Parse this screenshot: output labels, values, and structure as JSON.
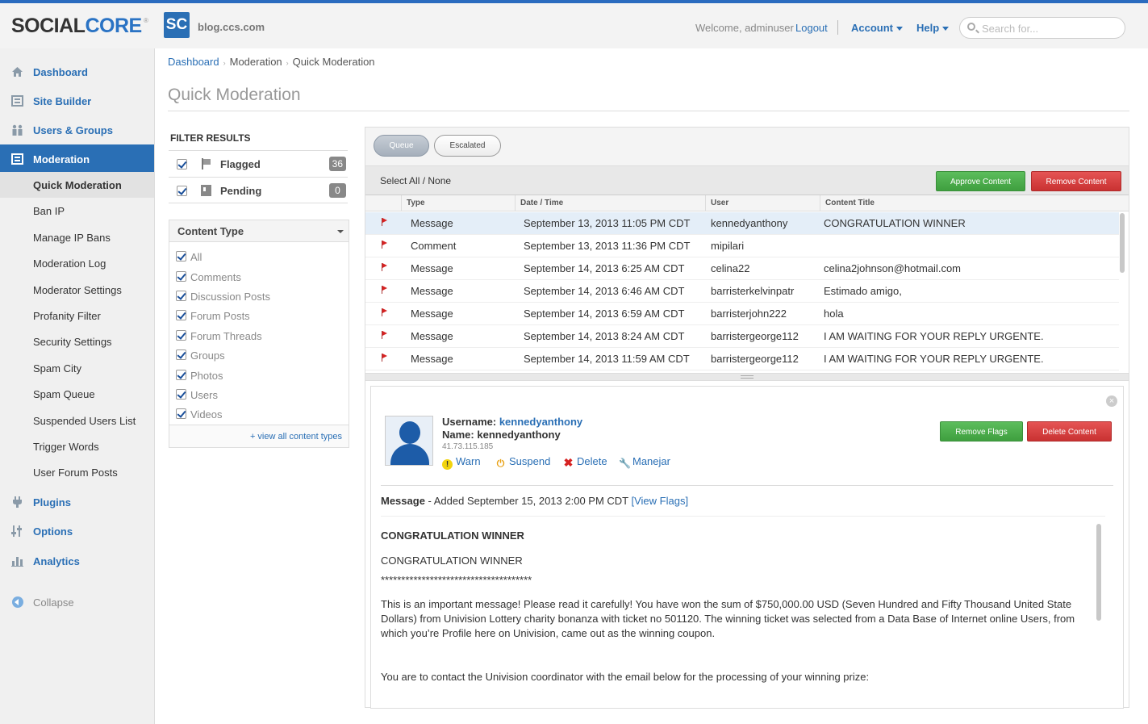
{
  "header": {
    "logo_social": "SOCIAL",
    "logo_core": "CORE",
    "logo_reg": "®",
    "site_badge": "SC",
    "site_url": "blog.ccs.com",
    "welcome": "Welcome, adminuser",
    "logout": "Logout",
    "account": "Account",
    "help": "Help",
    "search_placeholder": "Search for..."
  },
  "sidebar": {
    "main": [
      {
        "label": "Dashboard",
        "icon": "home-icon"
      },
      {
        "label": "Site Builder",
        "icon": "site-builder-icon"
      },
      {
        "label": "Users & Groups",
        "icon": "users-icon"
      },
      {
        "label": "Moderation",
        "icon": "moderation-icon"
      }
    ],
    "sub": [
      "Quick Moderation",
      "Ban IP",
      "Manage IP Bans",
      "Moderation Log",
      "Moderator Settings",
      "Profanity Filter",
      "Security Settings",
      "Spam City",
      "Spam Queue",
      "Suspended Users List",
      "Trigger Words",
      "User Forum Posts"
    ],
    "main2": [
      {
        "label": "Plugins",
        "icon": "plug-icon"
      },
      {
        "label": "Options",
        "icon": "options-icon"
      },
      {
        "label": "Analytics",
        "icon": "analytics-icon"
      }
    ],
    "collapse": "Collapse"
  },
  "breadcrumb": [
    "Dashboard",
    "Moderation",
    "Quick Moderation"
  ],
  "page_title": "Quick Moderation",
  "filter": {
    "heading": "FILTER RESULTS",
    "items": [
      {
        "label": "Flagged",
        "count": "36"
      },
      {
        "label": "Pending",
        "count": "0"
      }
    ]
  },
  "content_type": {
    "heading": "Content Type",
    "items": [
      "All",
      "Comments",
      "Discussion Posts",
      "Forum Posts",
      "Forum Threads",
      "Groups",
      "Photos",
      "Users",
      "Videos"
    ],
    "view_all": "+ view all content types"
  },
  "queue": {
    "tabs": [
      "Queue",
      "Escalated"
    ],
    "select_all": "Select All / None",
    "approve": "Approve Content",
    "remove": "Remove Content",
    "columns": [
      "Type",
      "Date / Time",
      "User",
      "Content Title"
    ],
    "rows": [
      {
        "type": "Message",
        "date": "September 13, 2013 11:05 PM CDT",
        "user": "kennedyanthony",
        "title": "CONGRATULATION WINNER"
      },
      {
        "type": "Comment",
        "date": "September 13, 2013 11:36 PM CDT",
        "user": "mipilari",
        "title": ""
      },
      {
        "type": "Message",
        "date": "September 14, 2013 6:25 AM CDT",
        "user": "celina22",
        "title": "celina2johnson@hotmail.com"
      },
      {
        "type": "Message",
        "date": "September 14, 2013 6:46 AM CDT",
        "user": "barristerkelvinpatr",
        "title": "Estimado amigo,"
      },
      {
        "type": "Message",
        "date": "September 14, 2013 6:59 AM CDT",
        "user": "barristerjohn222",
        "title": "hola"
      },
      {
        "type": "Message",
        "date": "September 14, 2013 8:24 AM CDT",
        "user": "barristergeorge112",
        "title": "I AM WAITING FOR YOUR REPLY URGENTE."
      },
      {
        "type": "Message",
        "date": "September 14, 2013 11:59 AM CDT",
        "user": "barristergeorge112",
        "title": "I AM WAITING FOR YOUR REPLY URGENTE."
      }
    ]
  },
  "detail": {
    "username_label": "Username:",
    "username": "kennedyanthony",
    "name_label": "Name:",
    "name": "kennedyanthony",
    "ip": "41.73.115.185",
    "actions": [
      "Warn",
      "Suspend",
      "Delete",
      "Manejar"
    ],
    "remove_flags": "Remove Flags",
    "delete_content": "Delete Content",
    "meta_type": "Message",
    "meta_added": " - Added September 15, 2013 2:00 PM CDT ",
    "meta_link": "[View Flags]",
    "body": [
      "CONGRATULATION WINNER",
      "CONGRATULATION WINNER",
      "*************************************",
      "This is an important message! Please read it carefully! You have won the sum of $750,000.00 USD (Seven Hundred and Fifty Thousand United State Dollars) from Univision Lottery charity bonanza with ticket no 501120. The winning ticket was selected from a Data Base of Internet online Users, from which you’re Profile here on Univision, came out as the winning coupon.",
      "You are to contact the Univision coordinator with the email below for the processing of your winning prize:"
    ]
  },
  "colors": {
    "accent": "#2a6fb5",
    "approve_green": "#4cae4c",
    "remove_red": "#d9534f",
    "flag_red": "#d62222"
  }
}
